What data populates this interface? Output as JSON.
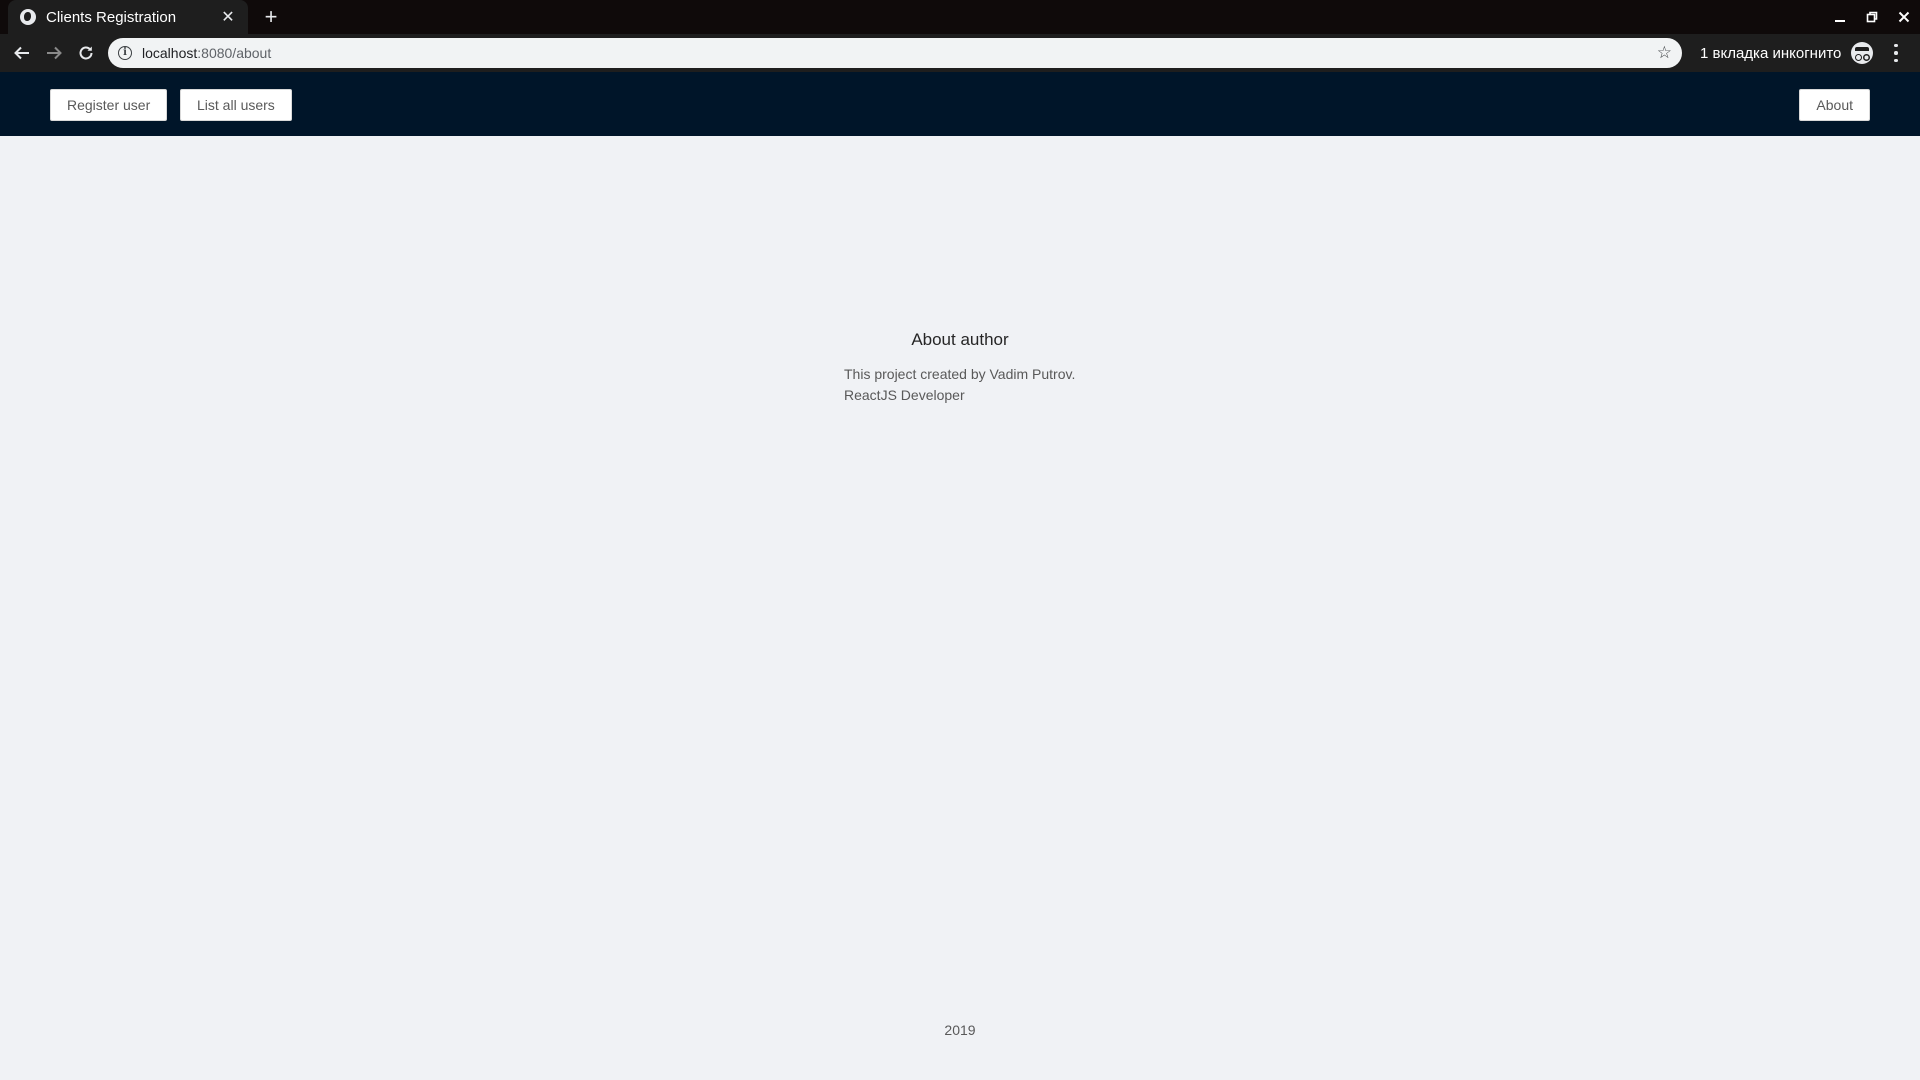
{
  "browser": {
    "tab_title": "Clients Registration",
    "url_host": "localhost",
    "url_rest": ":8080/about",
    "incognito_text": "1 вкладка инкогнито"
  },
  "nav": {
    "register_label": "Register user",
    "list_label": "List all users",
    "about_label": "About"
  },
  "about": {
    "title": "About author",
    "line1": "This project created by Vadim Putrov.",
    "line2": "ReactJS Developer"
  },
  "footer": {
    "year": "2019"
  },
  "colors": {
    "navbar_bg": "#001529",
    "page_bg": "#f0f2f5",
    "chrome_bg": "#1e1e1e"
  }
}
